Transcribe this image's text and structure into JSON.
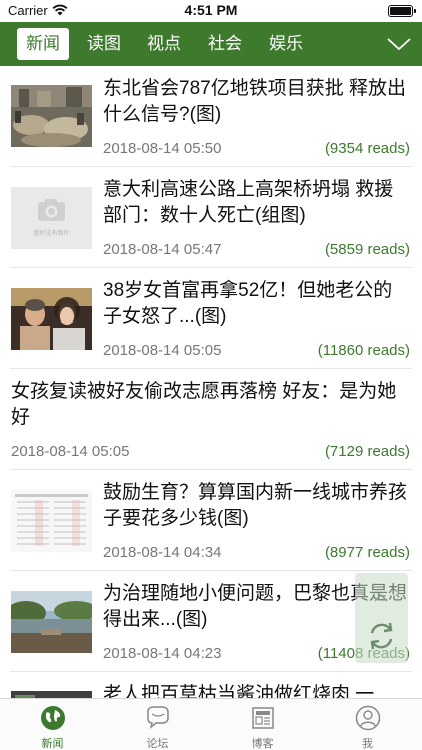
{
  "status_bar": {
    "carrier": "Carrier",
    "time": "4:51 PM",
    "wifi_icon": "wifi-icon",
    "battery_icon": "battery-icon"
  },
  "nav": {
    "tabs": [
      {
        "label": "新闻",
        "active": true
      },
      {
        "label": "读图",
        "active": false
      },
      {
        "label": "视点",
        "active": false
      },
      {
        "label": "社会",
        "active": false
      },
      {
        "label": "娱乐",
        "active": false
      }
    ],
    "expand_icon": "chevron-down-icon",
    "accent_color": "#3d7a2e"
  },
  "placeholder_text": "暂时没有图片",
  "articles": [
    {
      "title": "东北省会787亿地铁项目获批 释放出什么信号?(图)",
      "date": "2018-08-14 05:50",
      "reads": "(9354 reads)",
      "thumb": "market-photo"
    },
    {
      "title": "意大利高速公路上高架桥坍塌 救援部门：数十人死亡(组图)",
      "date": "2018-08-14 05:47",
      "reads": "(5859 reads)",
      "thumb": "placeholder"
    },
    {
      "title": "38岁女首富再拿52亿！但她老公的子女怒了...(图)",
      "date": "2018-08-14 05:05",
      "reads": "(11860 reads)",
      "thumb": "couple-photo"
    },
    {
      "title": "女孩复读被好友偷改志愿再落榜 好友：是为她好",
      "date": "2018-08-14 05:05",
      "reads": "(7129 reads)",
      "thumb": "none"
    },
    {
      "title": "鼓励生育？算算国内新一线城市养孩子要花多少钱(图)",
      "date": "2018-08-14 04:34",
      "reads": "(8977 reads)",
      "thumb": "table-image"
    },
    {
      "title": "为治理随地小便问题，巴黎也真是想得出来...(图)",
      "date": "2018-08-14 04:23",
      "reads": "(11408 reads)",
      "thumb": "river-photo"
    },
    {
      "title": "老人把百草枯当酱油做红烧肉 一",
      "date": "",
      "reads": "",
      "thumb": "partial-photo"
    }
  ],
  "tabbar": [
    {
      "label": "新闻",
      "icon": "globe-icon",
      "active": true
    },
    {
      "label": "论坛",
      "icon": "chat-bubble-icon",
      "active": false
    },
    {
      "label": "博客",
      "icon": "newspaper-icon",
      "active": false
    },
    {
      "label": "我",
      "icon": "user-icon",
      "active": false
    }
  ],
  "refresh_icon": "refresh-icon"
}
